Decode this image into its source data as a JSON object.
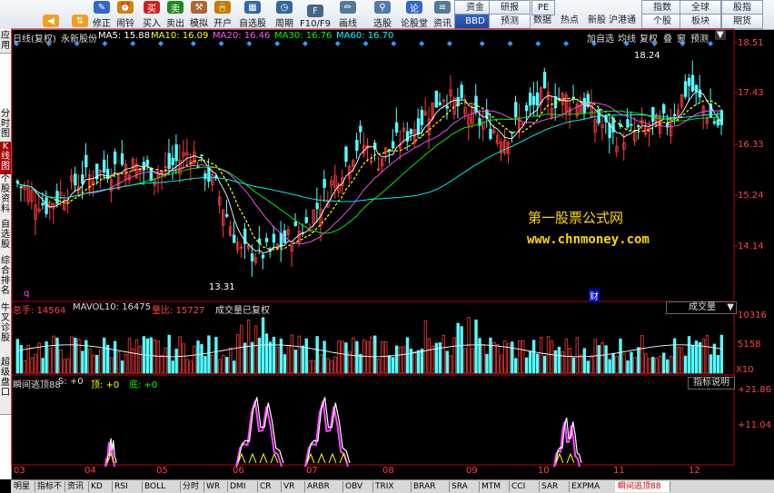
{
  "toolbar": {
    "buttons": [
      {
        "label": "",
        "icon": "back-arrow-icon"
      },
      {
        "label": "",
        "icon": "up-down-arrow-icon"
      },
      {
        "label": "修正",
        "icon": "edit-icon"
      },
      {
        "label": "闹铃",
        "icon": "alarm-clock-icon"
      },
      {
        "label": "买入",
        "icon": "buy-icon"
      },
      {
        "label": "卖出",
        "icon": "sell-icon"
      },
      {
        "label": "模拟",
        "icon": "hammer-icon"
      },
      {
        "label": "开户",
        "icon": "account-icon"
      },
      {
        "label": "自选股",
        "icon": "grid-icon"
      },
      {
        "label": "周期",
        "icon": "clock-icon"
      },
      {
        "label": "F10/F9",
        "icon": "f10-icon"
      },
      {
        "label": "画线",
        "icon": "pencil-icon"
      },
      {
        "label": "选股",
        "icon": "pick-icon"
      },
      {
        "label": "论股堂",
        "icon": "chat-icon"
      },
      {
        "label": "资讯",
        "icon": "news-icon"
      }
    ],
    "right_top": [
      "资金",
      "研报",
      "PE",
      "指数",
      "全球",
      "股指"
    ],
    "right_bottom": [
      "BBD",
      "预测",
      "数据",
      "热点",
      "新股",
      "沪港通",
      "个股",
      "板块",
      "期货"
    ]
  },
  "side_tabs": [
    "应用",
    "分时图",
    "K线图",
    "个股资料",
    "自选股",
    "综合排名",
    "牛叉诊股",
    "超级盘口"
  ],
  "main_header": {
    "period": "日线(复权)",
    "stock": "永新股份",
    "ma5": "MA5: 15.88",
    "ma10": "MA10: 16.09",
    "ma20": "MA20: 16.46",
    "ma30": "MA30: 16.76",
    "ma60": "MA60: 16.70",
    "menu": [
      "加自选",
      "均线",
      "复权",
      "叠",
      "窗",
      "预测"
    ]
  },
  "price_axis": [
    "18.51",
    "17.43",
    "16.33",
    "15.24",
    "14.14"
  ],
  "price_annotations": {
    "high": "18.24",
    "low": "13.31"
  },
  "volume_header": {
    "zongshou": "总手: 14564",
    "mavol": "MAVOL10: 16475",
    "liangbi": "量比: 15727",
    "note": "成交量已复权",
    "select": "成交量"
  },
  "volume_axis": [
    "10316",
    "5158",
    "X10"
  ],
  "indicator_header": {
    "name": "瞬间逃顶88",
    "s": "S: +0",
    "ding": "顶: +0",
    "di": "底: +0",
    "button": "指标说明"
  },
  "indicator_axis": [
    "+21.86",
    "+11.04"
  ],
  "x_axis": [
    "03",
    "04",
    "05",
    "06",
    "07",
    "08",
    "09",
    "10",
    "11",
    "12"
  ],
  "markers": {
    "q": "q",
    "cai": "财"
  },
  "bottom_tabs": [
    "明星",
    "指标不",
    "资讯",
    "KD",
    "RSI",
    "BOLL",
    "分时",
    "WR",
    "DMI",
    "CR",
    "VR",
    "ARBR",
    "OBV",
    "TRIX",
    "BRAR",
    "SRA",
    "MTM",
    "CCI",
    "SAR",
    "EXPMA",
    "瞬间逃顶88"
  ],
  "watermark": {
    "title": "第一股票公式网",
    "url": "www.chnmoney.com"
  },
  "colors": {
    "up": "#ff3b3b",
    "down": "#54ffff",
    "ma5": "#ffffff",
    "ma10": "#ffff00",
    "ma20": "#ff55ff",
    "ma30": "#00ff00",
    "ma60": "#00ffff",
    "axis": "#c00000"
  }
}
